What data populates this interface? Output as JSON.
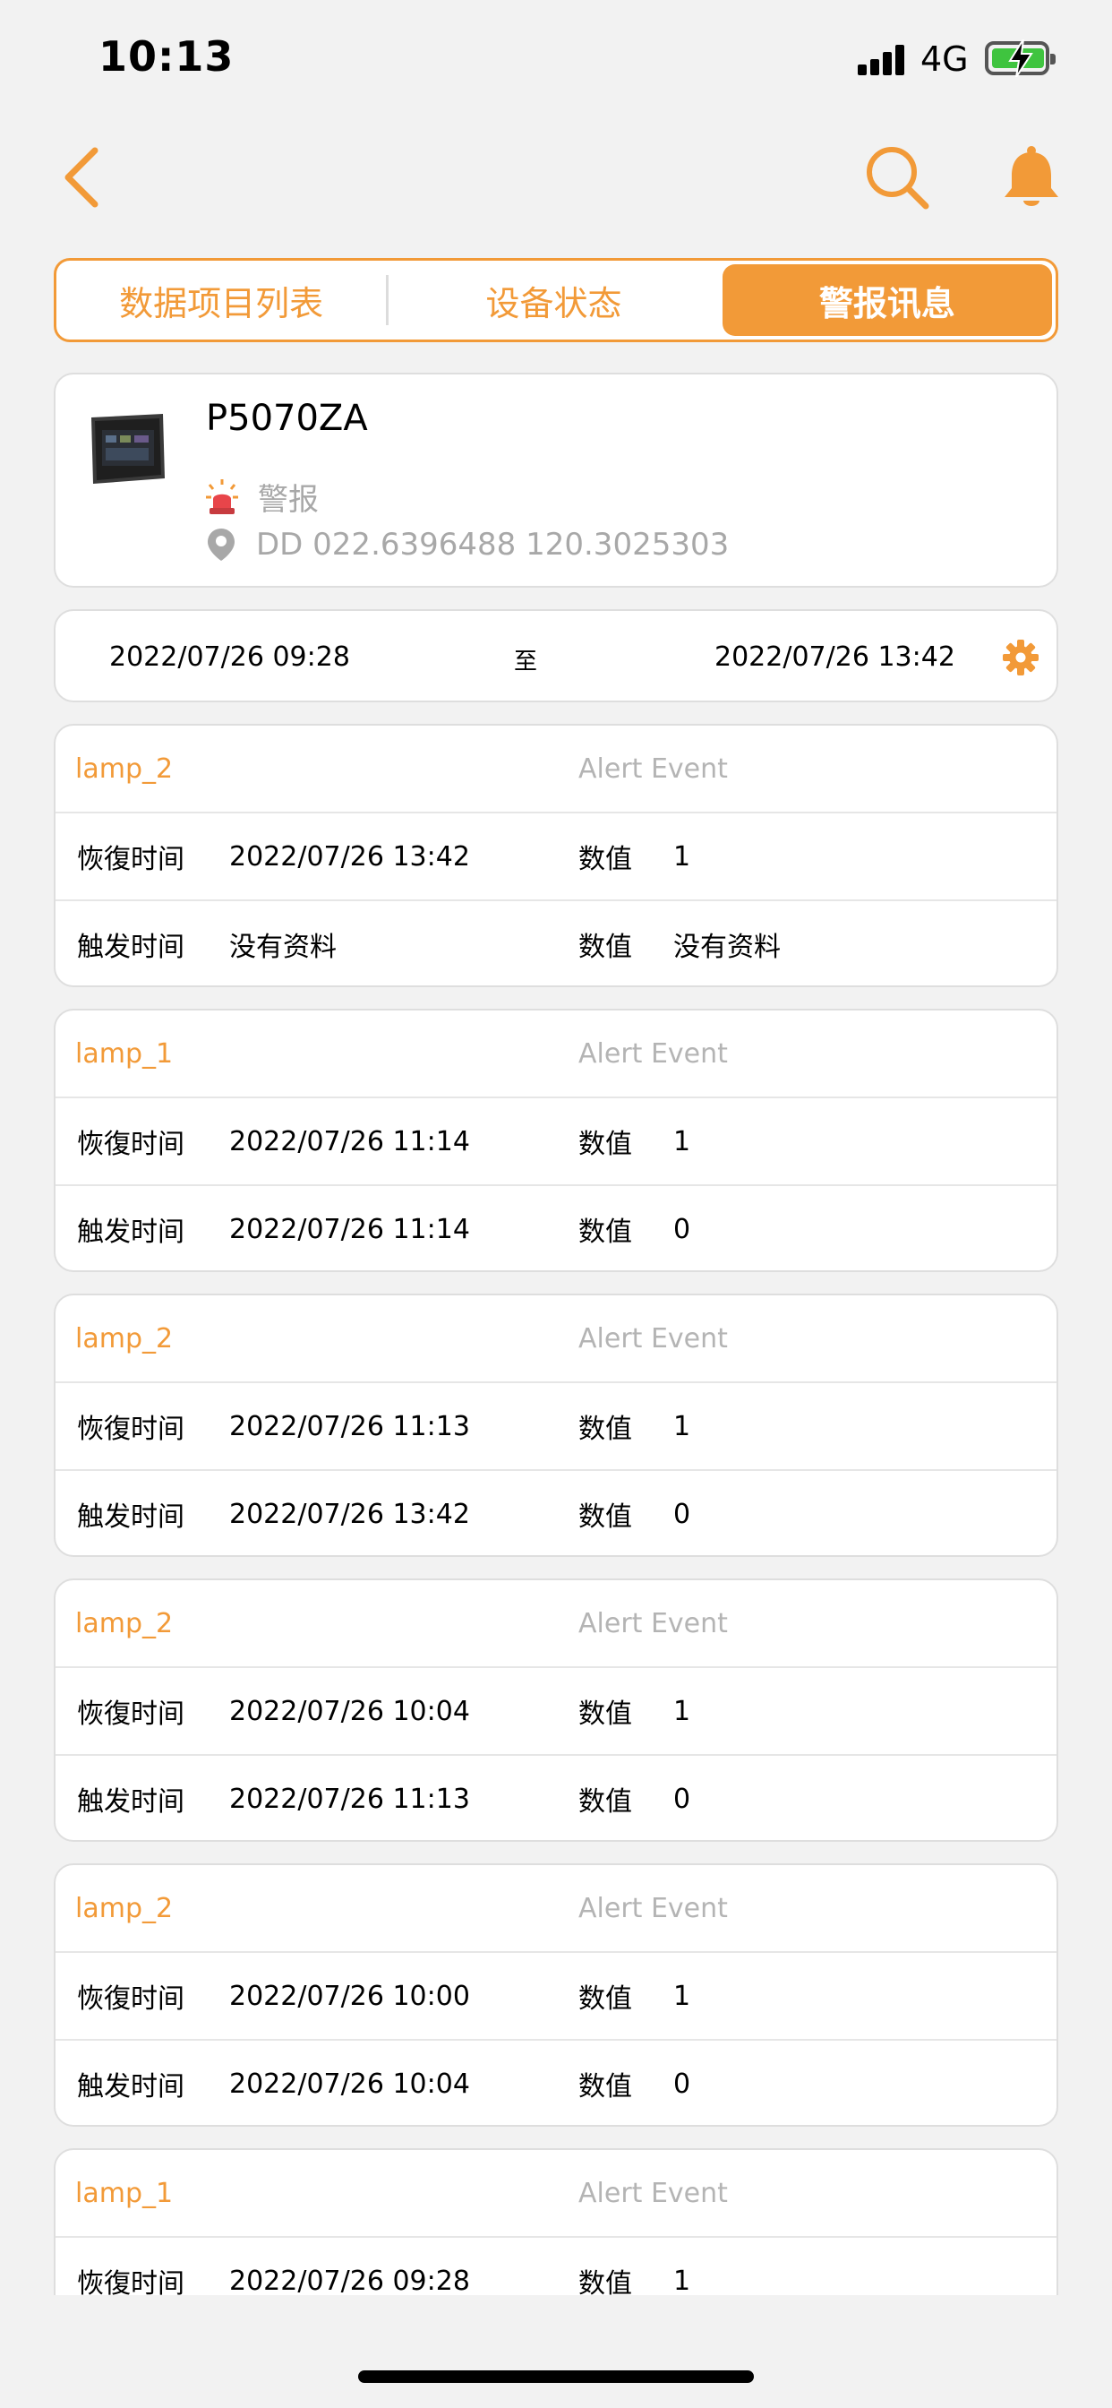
{
  "status_bar": {
    "time": "10:13",
    "network": "4G"
  },
  "colors": {
    "accent": "#f29a38",
    "muted": "#a8a8a8",
    "background": "#f2f2f2"
  },
  "nav": {
    "back_icon": "chevron-left-icon",
    "search_icon": "search-icon",
    "bell_icon": "bell-icon"
  },
  "tabs": [
    {
      "label": "数据项目列表",
      "active": false
    },
    {
      "label": "设备状态",
      "active": false
    },
    {
      "label": "警报讯息",
      "active": true
    }
  ],
  "device": {
    "name": "P5070ZA",
    "alarm_label": "警报",
    "location": "DD 022.6396488 120.3025303"
  },
  "date_range": {
    "start": "2022/07/26 09:28",
    "separator": "至",
    "end": "2022/07/26 13:42"
  },
  "alerts": [
    {
      "name": "lamp_2",
      "type": "Alert Event",
      "restore_label": "恢復时间",
      "restore_time": "2022/07/26 13:42",
      "restore_value_label": "数值",
      "restore_value": "1",
      "trigger_label": "触发时间",
      "trigger_time": "没有资料",
      "trigger_value_label": "数值",
      "trigger_value": "没有资料"
    },
    {
      "name": "lamp_1",
      "type": "Alert Event",
      "restore_label": "恢復时间",
      "restore_time": "2022/07/26 11:14",
      "restore_value_label": "数值",
      "restore_value": "1",
      "trigger_label": "触发时间",
      "trigger_time": "2022/07/26 11:14",
      "trigger_value_label": "数值",
      "trigger_value": "0"
    },
    {
      "name": "lamp_2",
      "type": "Alert Event",
      "restore_label": "恢復时间",
      "restore_time": "2022/07/26 11:13",
      "restore_value_label": "数值",
      "restore_value": "1",
      "trigger_label": "触发时间",
      "trigger_time": "2022/07/26 13:42",
      "trigger_value_label": "数值",
      "trigger_value": "0"
    },
    {
      "name": "lamp_2",
      "type": "Alert Event",
      "restore_label": "恢復时间",
      "restore_time": "2022/07/26 10:04",
      "restore_value_label": "数值",
      "restore_value": "1",
      "trigger_label": "触发时间",
      "trigger_time": "2022/07/26 11:13",
      "trigger_value_label": "数值",
      "trigger_value": "0"
    },
    {
      "name": "lamp_2",
      "type": "Alert Event",
      "restore_label": "恢復时间",
      "restore_time": "2022/07/26 10:00",
      "restore_value_label": "数值",
      "restore_value": "1",
      "trigger_label": "触发时间",
      "trigger_time": "2022/07/26 10:04",
      "trigger_value_label": "数值",
      "trigger_value": "0"
    },
    {
      "name": "lamp_1",
      "type": "Alert Event",
      "restore_label": "恢復时间",
      "restore_time": "2022/07/26 09:28",
      "restore_value_label": "数值",
      "restore_value": "1",
      "trigger_label": "",
      "trigger_time": "",
      "trigger_value_label": "",
      "trigger_value": ""
    }
  ]
}
